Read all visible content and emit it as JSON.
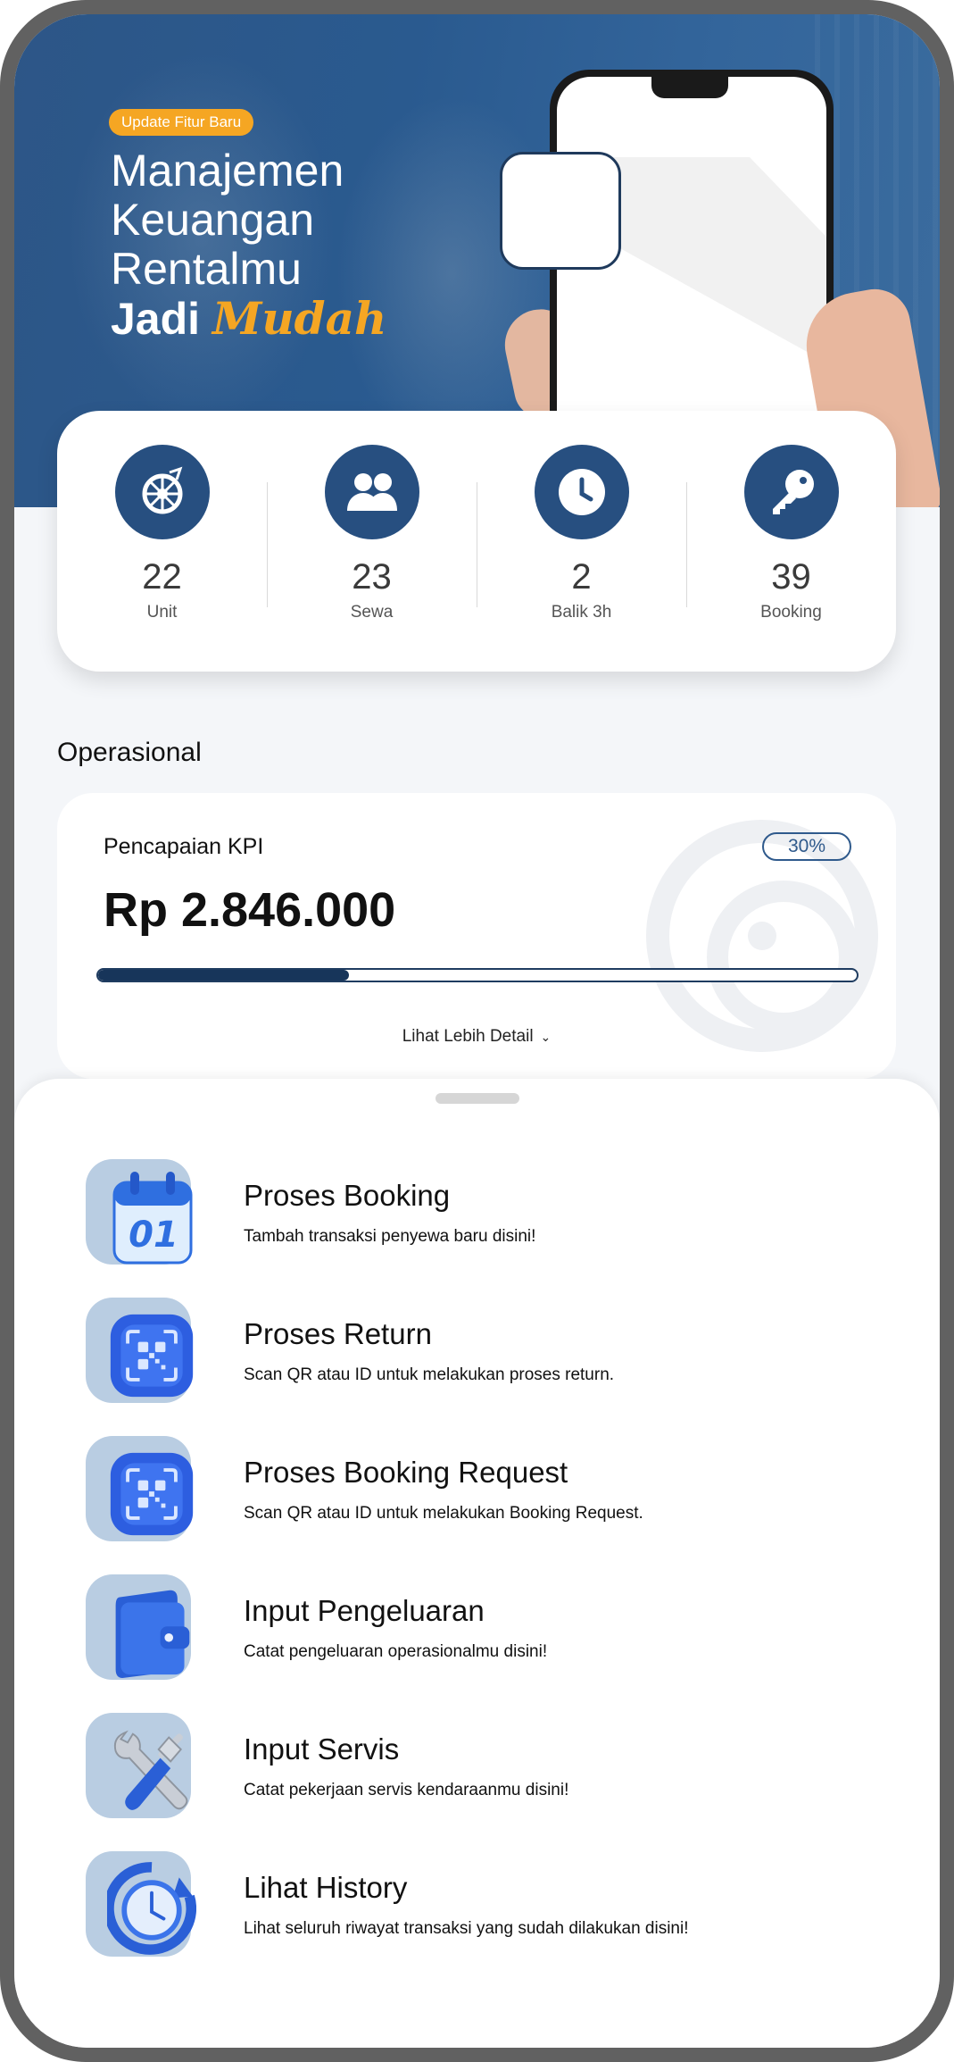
{
  "hero": {
    "badge": "Update Fitur Baru",
    "title_lines": [
      "Manajemen",
      "Keuangan",
      "Rentalmu"
    ],
    "title_last_word": "Jadi",
    "title_accent": "Mudah",
    "accent_color": "#f5a623",
    "brand_color": "#274f80"
  },
  "stats": [
    {
      "icon": "wheel-icon",
      "value": "22",
      "label": "Unit"
    },
    {
      "icon": "users-icon",
      "value": "23",
      "label": "Sewa"
    },
    {
      "icon": "clock-icon",
      "value": "2",
      "label": "Balik 3h"
    },
    {
      "icon": "key-icon",
      "value": "39",
      "label": "Booking"
    }
  ],
  "operasional": {
    "section_title": "Operasional",
    "kpi_label": "Pencapaian KPI",
    "kpi_amount": "Rp 2.846.000",
    "kpi_percent_label": "30%",
    "kpi_progress": 0.33,
    "detail_label": "Lihat Lebih Detail"
  },
  "actions": [
    {
      "icon": "calendar-icon",
      "title": "Proses Booking",
      "desc": "Tambah transaksi penyewa baru disini!",
      "calendar_number": "01"
    },
    {
      "icon": "qr-scan-icon",
      "title": "Proses Return",
      "desc": "Scan QR atau ID untuk melakukan proses return."
    },
    {
      "icon": "qr-scan-icon",
      "title": "Proses Booking Request",
      "desc": "Scan QR atau ID untuk melakukan Booking Request."
    },
    {
      "icon": "wallet-icon",
      "title": "Input Pengeluaran",
      "desc": "Catat pengeluaran operasionalmu disini!"
    },
    {
      "icon": "tools-icon",
      "title": "Input Servis",
      "desc": "Catat pekerjaan servis kendaraanmu disini!"
    },
    {
      "icon": "history-clock-icon",
      "title": "Lihat History",
      "desc": "Lihat seluruh riwayat transaksi yang sudah dilakukan disini!"
    }
  ]
}
